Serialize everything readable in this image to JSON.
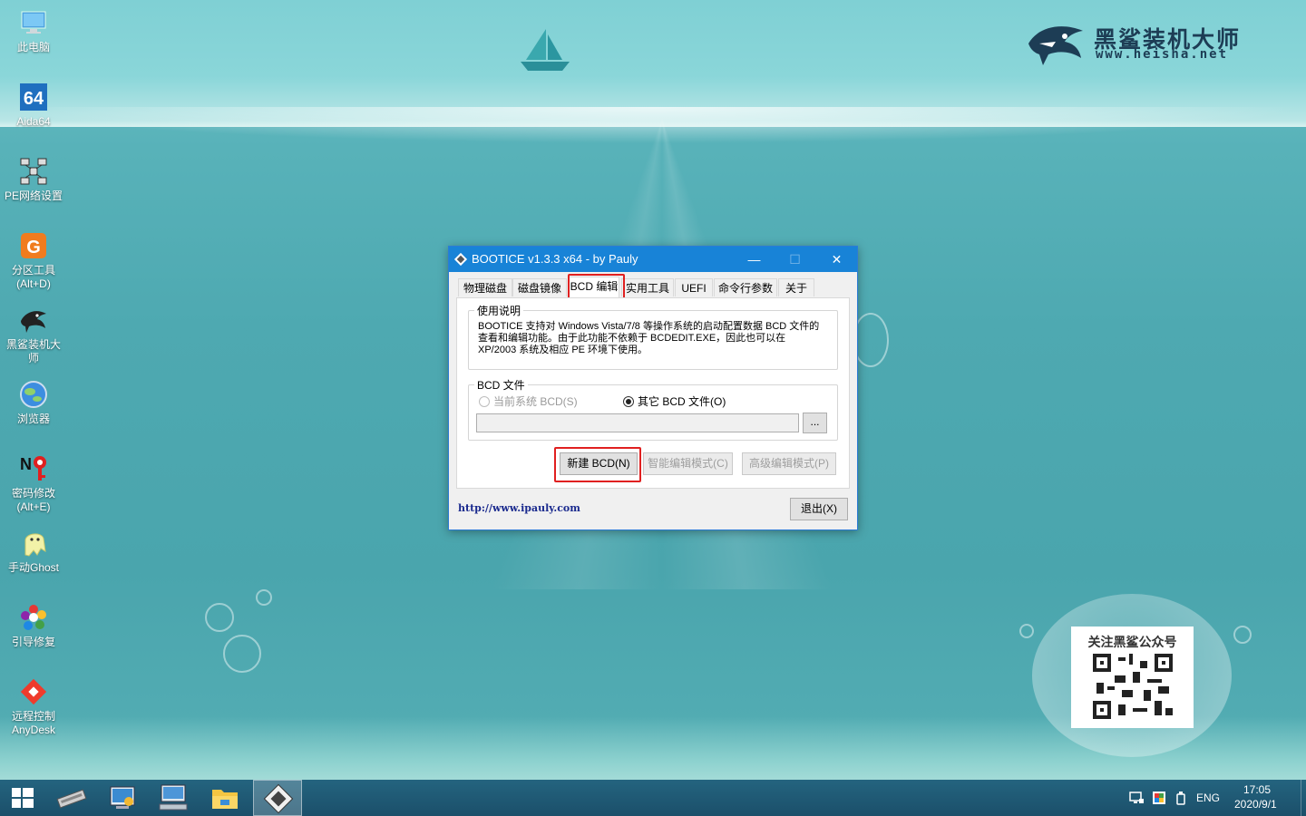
{
  "desktop": {
    "icons": [
      {
        "label": "此电脑",
        "icon": "computer-icon"
      },
      {
        "label": "Aida64",
        "icon": "aida64-icon"
      },
      {
        "label": "PE网络设置",
        "icon": "network-icon"
      },
      {
        "label": "分区工具\n(Alt+D)",
        "icon": "partition-tool-icon"
      },
      {
        "label": "黑鲨装机大\n师",
        "icon": "heisha-icon"
      },
      {
        "label": "浏览器",
        "icon": "browser-icon"
      },
      {
        "label": "密码修改\n(Alt+E)",
        "icon": "password-icon"
      },
      {
        "label": "手动Ghost",
        "icon": "ghost-icon"
      },
      {
        "label": "引导修复",
        "icon": "boot-repair-icon"
      },
      {
        "label": "远程控制\nAnyDesk",
        "icon": "anydesk-icon"
      }
    ],
    "brand": {
      "title": "黑鲨装机大师",
      "url": "www.heisha.net"
    },
    "qr": {
      "title": "关注黑鲨公众号"
    }
  },
  "dialog": {
    "title": "BOOTICE v1.3.3 x64 - by Pauly",
    "controls": {
      "minimize": "—",
      "maximize": "☐",
      "close": "✕"
    },
    "tabs": [
      {
        "label": "物理磁盘",
        "active": false
      },
      {
        "label": "磁盘镜像",
        "active": false
      },
      {
        "label": "BCD 编辑",
        "active": true
      },
      {
        "label": "实用工具",
        "active": false
      },
      {
        "label": "UEFI",
        "active": false
      },
      {
        "label": "命令行参数",
        "active": false
      },
      {
        "label": "关于",
        "active": false
      }
    ],
    "usage": {
      "title": "使用说明",
      "text": "BOOTICE 支持对 Windows Vista/7/8 等操作系统的启动配置数据 BCD 文件的查看和编辑功能。由于此功能不依赖于 BCDEDIT.EXE，因此也可以在 XP/2003 系统及相应 PE 环境下使用。"
    },
    "bcd_file": {
      "title": "BCD 文件",
      "option_current": "当前系统 BCD(S)",
      "option_other": "其它 BCD 文件(O)",
      "selected": "other",
      "path_value": "",
      "browse_label": "..."
    },
    "buttons": {
      "new_bcd": "新建 BCD(N)",
      "smart_edit": "智能编辑模式(C)",
      "advanced_edit": "高级编辑模式(P)",
      "exit": "退出(X)"
    },
    "link": "http://www.ipauly.com"
  },
  "taskbar": {
    "items": [
      "start-icon",
      "disk-tool-icon",
      "control-panel-icon",
      "remote-desktop-icon",
      "file-explorer-icon",
      "bootice-icon"
    ],
    "active_item": "bootice-icon",
    "language": "ENG",
    "time": "17:05",
    "date": "2020/9/1"
  },
  "colors": {
    "titlebar": "#1883d7",
    "highlight": "#e02020",
    "taskbar": "#1e5573"
  }
}
